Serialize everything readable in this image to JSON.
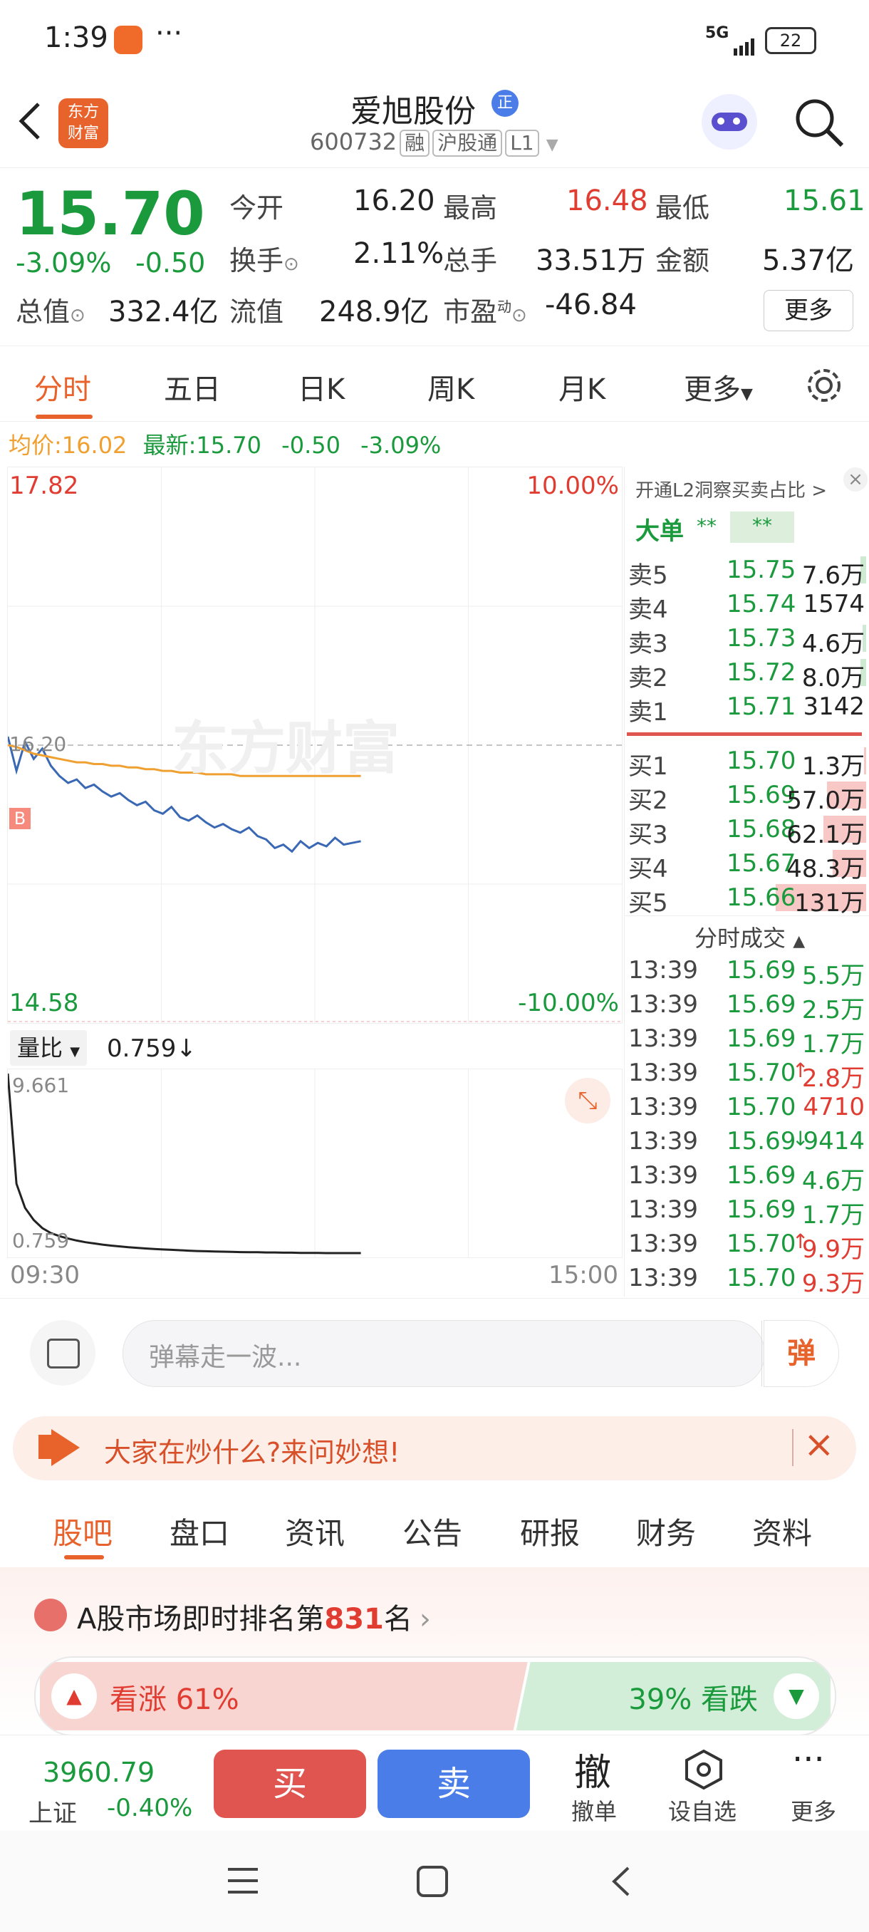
{
  "status_bar": {
    "time": "1:39",
    "dots": "···",
    "network": "5G",
    "battery": "22"
  },
  "header": {
    "logo_line1": "东方",
    "logo_line2": "财富",
    "stock_name": "爱旭股份",
    "stock_code": "600732",
    "tags": [
      "融",
      "沪股通",
      "L1"
    ],
    "badge": "正"
  },
  "quote": {
    "price": "15.70",
    "change_pct": "-3.09%",
    "change": "-0.50",
    "labels": {
      "open": "今开",
      "high": "最高",
      "low": "最低",
      "turnover": "换手",
      "volume": "总手",
      "amount": "金额",
      "market_cap": "总值",
      "float_cap": "流值",
      "pe": "市盈",
      "pe_sup": "动"
    },
    "values": {
      "open": "16.20",
      "high": "16.48",
      "low": "15.61",
      "turnover": "2.11%",
      "volume": "33.51万",
      "amount": "5.37亿",
      "market_cap": "332.4亿",
      "float_cap": "248.9亿",
      "pe": "-46.84"
    },
    "more_button": "更多"
  },
  "chart_tabs": [
    "分时",
    "五日",
    "日K",
    "周K",
    "月K",
    "更多"
  ],
  "avg_line": {
    "avg_label": "均价:",
    "avg_value": "16.02",
    "latest_label": "最新:",
    "latest_value": "15.70",
    "latest_change": "-0.50",
    "latest_pct": "-3.09%"
  },
  "chart": {
    "y_top": "17.82",
    "y_bottom": "14.58",
    "pct_top": "10.00%",
    "pct_bottom": "-10.00%",
    "ref_label": "16.20",
    "b_marker": "B",
    "watermark": "东方财富",
    "vol_ratio_label": "量比",
    "vol_ratio_value": "0.759",
    "vol_ratio_arrow": "↓",
    "vr_top": "9.661",
    "vr_bottom": "0.759",
    "time_start": "09:30",
    "time_end": "15:00"
  },
  "chart_data": {
    "type": "line",
    "title": "",
    "ylim": [
      14.58,
      17.82
    ],
    "reference": 16.2,
    "series": [
      {
        "name": "price",
        "values": [
          16.25,
          16.05,
          16.22,
          16.12,
          16.18,
          16.08,
          16.02,
          15.98,
          16.0,
          15.95,
          15.97,
          15.93,
          15.9,
          15.92,
          15.88,
          15.85,
          15.87,
          15.82,
          15.8,
          15.84,
          15.78,
          15.76,
          15.79,
          15.75,
          15.72,
          15.74,
          15.71,
          15.69,
          15.72,
          15.67,
          15.65,
          15.6,
          15.62,
          15.58,
          15.64,
          15.6,
          15.63,
          15.61,
          15.66,
          15.62,
          15.63,
          15.64
        ]
      },
      {
        "name": "avg",
        "values": [
          16.2,
          16.19,
          16.17,
          16.15,
          16.14,
          16.13,
          16.12,
          16.11,
          16.1,
          16.1,
          16.09,
          16.09,
          16.08,
          16.08,
          16.07,
          16.07,
          16.06,
          16.06,
          16.05,
          16.05,
          16.04,
          16.04,
          16.04,
          16.03,
          16.03,
          16.03,
          16.03,
          16.02,
          16.02,
          16.02,
          16.02,
          16.02,
          16.02,
          16.02,
          16.02,
          16.02,
          16.02,
          16.02,
          16.02,
          16.02,
          16.02,
          16.02
        ]
      }
    ],
    "vol_ratio": {
      "ylim": [
        0.759,
        9.661
      ],
      "values": [
        9.661,
        4.2,
        3.0,
        2.4,
        2.0,
        1.75,
        1.6,
        1.48,
        1.38,
        1.3,
        1.24,
        1.18,
        1.13,
        1.09,
        1.05,
        1.02,
        0.99,
        0.96,
        0.94,
        0.92,
        0.9,
        0.88,
        0.86,
        0.85,
        0.84,
        0.83,
        0.82,
        0.81,
        0.8,
        0.8,
        0.79,
        0.79,
        0.78,
        0.78,
        0.77,
        0.77,
        0.77,
        0.76,
        0.76,
        0.76,
        0.759,
        0.759
      ]
    }
  },
  "orderbook": {
    "promo": "开通L2洞察买卖占比 >",
    "big_order_label": "大单",
    "big_masked1": "**",
    "big_masked2": "**",
    "asks": [
      {
        "label": "卖5",
        "price": "15.75",
        "vol": "7.6万",
        "pct": 0.06
      },
      {
        "label": "卖4",
        "price": "15.74",
        "vol": "1574",
        "pct": 0.0
      },
      {
        "label": "卖3",
        "price": "15.73",
        "vol": "4.6万",
        "pct": 0.04
      },
      {
        "label": "卖2",
        "price": "15.72",
        "vol": "8.0万",
        "pct": 0.06
      },
      {
        "label": "卖1",
        "price": "15.71",
        "vol": "3142",
        "pct": 0.0
      }
    ],
    "bids": [
      {
        "label": "买1",
        "price": "15.70",
        "vol": "1.3万",
        "pct": 0.02
      },
      {
        "label": "买2",
        "price": "15.69",
        "vol": "57.0万",
        "pct": 0.42
      },
      {
        "label": "买3",
        "price": "15.68",
        "vol": "62.1万",
        "pct": 0.46
      },
      {
        "label": "买4",
        "price": "15.67",
        "vol": "48.3万",
        "pct": 0.36
      },
      {
        "label": "买5",
        "price": "15.66",
        "vol": "131万",
        "pct": 0.98
      }
    ],
    "ticks_title": "分时成交",
    "ticks": [
      {
        "time": "13:39",
        "price": "15.69",
        "vol": "5.5万",
        "dir": "",
        "c": "green",
        "vc": "green"
      },
      {
        "time": "13:39",
        "price": "15.69",
        "vol": "2.5万",
        "dir": "",
        "c": "green",
        "vc": "green"
      },
      {
        "time": "13:39",
        "price": "15.69",
        "vol": "1.7万",
        "dir": "",
        "c": "green",
        "vc": "green"
      },
      {
        "time": "13:39",
        "price": "15.70",
        "vol": "2.8万",
        "dir": "↑",
        "c": "green",
        "vc": "red"
      },
      {
        "time": "13:39",
        "price": "15.70",
        "vol": "4710",
        "dir": "",
        "c": "green",
        "vc": "red"
      },
      {
        "time": "13:39",
        "price": "15.69",
        "vol": "9414",
        "dir": "↓",
        "c": "green",
        "vc": "green"
      },
      {
        "time": "13:39",
        "price": "15.69",
        "vol": "4.6万",
        "dir": "",
        "c": "green",
        "vc": "green"
      },
      {
        "time": "13:39",
        "price": "15.69",
        "vol": "1.7万",
        "dir": "",
        "c": "green",
        "vc": "green"
      },
      {
        "time": "13:39",
        "price": "15.70",
        "vol": "9.9万",
        "dir": "↑",
        "c": "green",
        "vc": "red"
      },
      {
        "time": "13:39",
        "price": "15.70",
        "vol": "9.3万",
        "dir": "",
        "c": "green",
        "vc": "red"
      }
    ]
  },
  "danmaku": {
    "placeholder": "弹幕走一波...",
    "send": "弹"
  },
  "banner": {
    "text": "大家在炒什么?来问妙想!"
  },
  "bottom_tabs": [
    "股吧",
    "盘口",
    "资讯",
    "公告",
    "研报",
    "财务",
    "资料"
  ],
  "rank": {
    "prefix": "A股市场即时排名第",
    "rank": "831",
    "suffix": "名"
  },
  "sentiment": {
    "up_label": "看涨",
    "up_pct": "61%",
    "down_label": "看跌",
    "down_pct": "39%",
    "up_ratio": 0.61
  },
  "footer": {
    "index_value": "3960.79",
    "index_name": "上证",
    "index_change": "-0.40%",
    "buy": "买",
    "sell": "卖",
    "cancel": "撤",
    "cancel_label": "撤单",
    "watch_label": "设自选",
    "more_label": "更多"
  },
  "colors": {
    "red": "#e03c31",
    "green": "#1a9a3c",
    "blue_line": "#3a68b5",
    "avg_line": "#f0a030",
    "buy_btn": "#e05550",
    "sell_btn": "#4a7de8",
    "accent": "#e8632c"
  }
}
